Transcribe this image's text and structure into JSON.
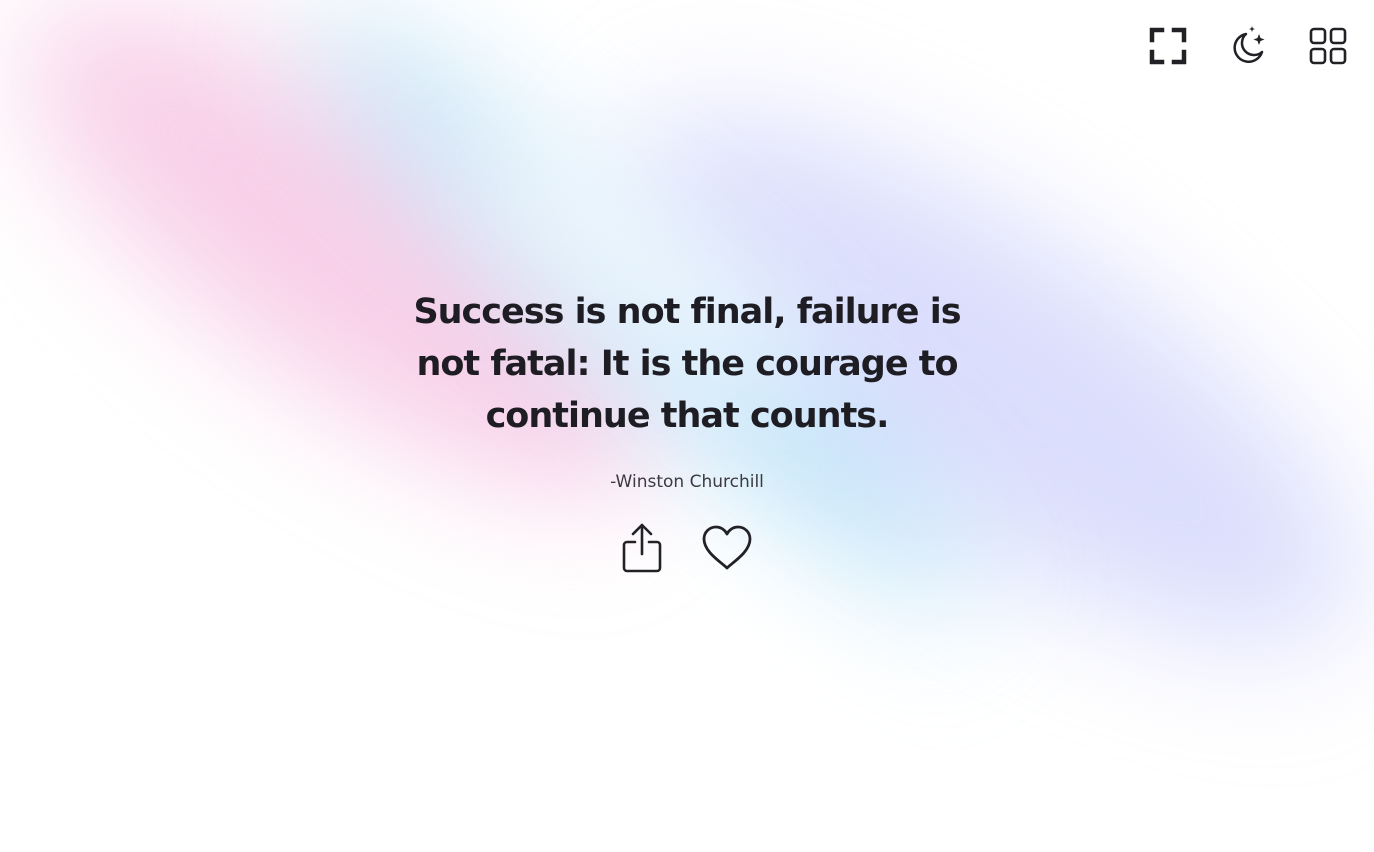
{
  "quote": {
    "text": "Success is not final, failure is not fatal: It is the courage to continue that counts.",
    "author": "-Winston Churchill"
  },
  "toolbar": {
    "items": [
      {
        "id": "fullscreen",
        "icon": "fullscreen-icon"
      },
      {
        "id": "theme",
        "icon": "moon-stars-icon"
      },
      {
        "id": "grid",
        "icon": "grid-icon"
      }
    ]
  },
  "actions": {
    "share_icon": "share-icon",
    "like_icon": "heart-icon"
  },
  "colors": {
    "text": "#1f1d24",
    "author_text": "#3b3a40",
    "icon": "#222126",
    "background": "#ffffff",
    "gradient_pink": "#f2aad7",
    "gradient_cyan": "#96d7f5",
    "gradient_lavender": "#bec3fa"
  }
}
